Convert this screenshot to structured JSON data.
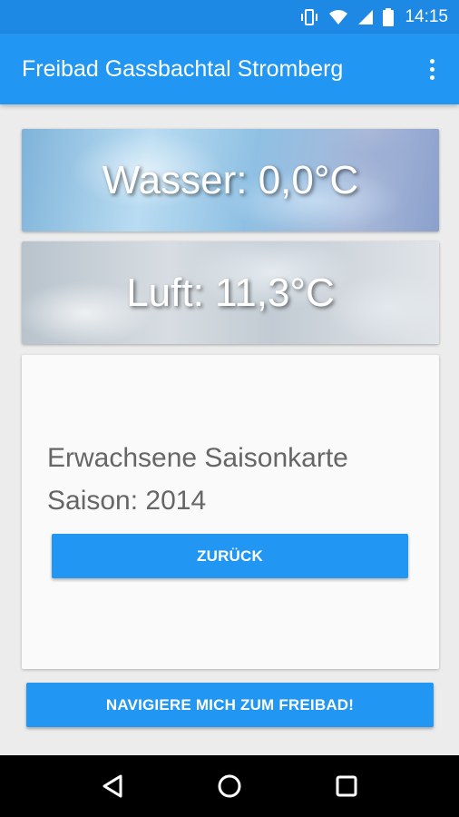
{
  "status_bar": {
    "time": "14:15",
    "icons": [
      "vibrate-icon",
      "wifi-icon",
      "signal-icon",
      "battery-icon"
    ]
  },
  "app_bar": {
    "title": "Freibad Gassbachtal Stromberg",
    "menu_icon": "overflow-menu-icon"
  },
  "weather": {
    "water": "Wasser: 0,0°C",
    "air": "Luft: 11,3°C"
  },
  "ticket": {
    "line1": "Erwachsene Saisonkarte",
    "line2": "Saison: 2014",
    "back_label": "ZURÜCK"
  },
  "navigate_label": "NAVIGIERE MICH ZUM FREIBAD!",
  "nav_bar": {
    "icons": [
      "back-icon",
      "home-icon",
      "recents-icon"
    ]
  },
  "colors": {
    "primary": "#2196f3",
    "status_bar": "#1e88e5"
  }
}
